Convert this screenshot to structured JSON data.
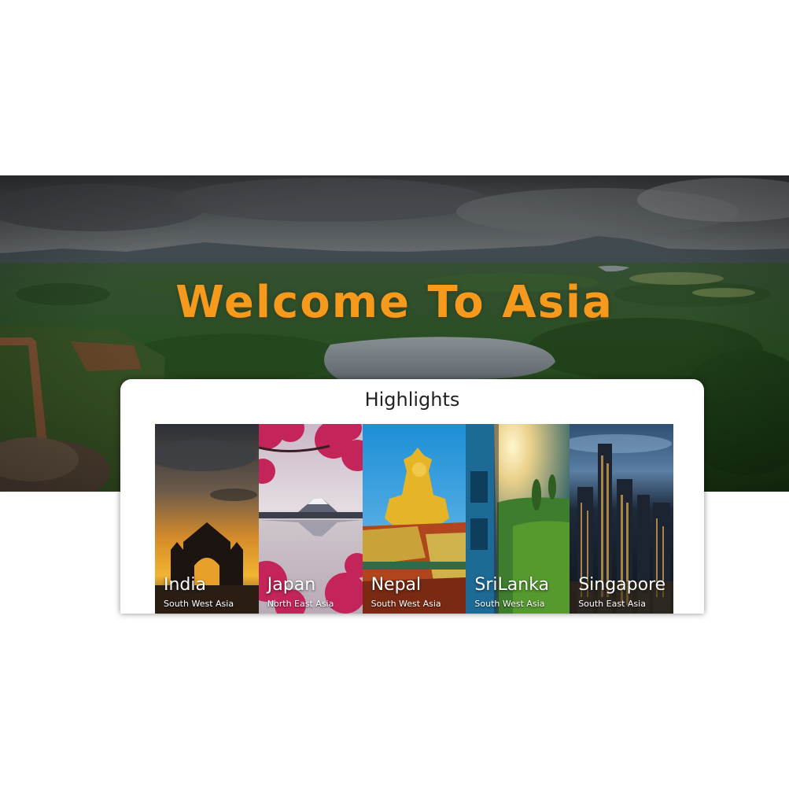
{
  "hero": {
    "title": "Welcome To Asia",
    "image": "landscape-aerial-forest-lake"
  },
  "highlights": {
    "title": "Highlights",
    "destinations": [
      {
        "name": "India",
        "region": "South West Asia",
        "image": "palace-gate-sunset"
      },
      {
        "name": "Japan",
        "region": "North East Asia",
        "image": "mount-fuji-cherry-blossom"
      },
      {
        "name": "Nepal",
        "region": "South West Asia",
        "image": "golden-buddha-statue"
      },
      {
        "name": "SriLanka",
        "region": "South West Asia",
        "image": "train-tea-hills"
      },
      {
        "name": "Singapore",
        "region": "South East Asia",
        "image": "city-skyscrapers"
      }
    ]
  },
  "colors": {
    "title_orange": "#f59a1c",
    "card_background": "#ffffff",
    "page_background": "#ffffff"
  }
}
